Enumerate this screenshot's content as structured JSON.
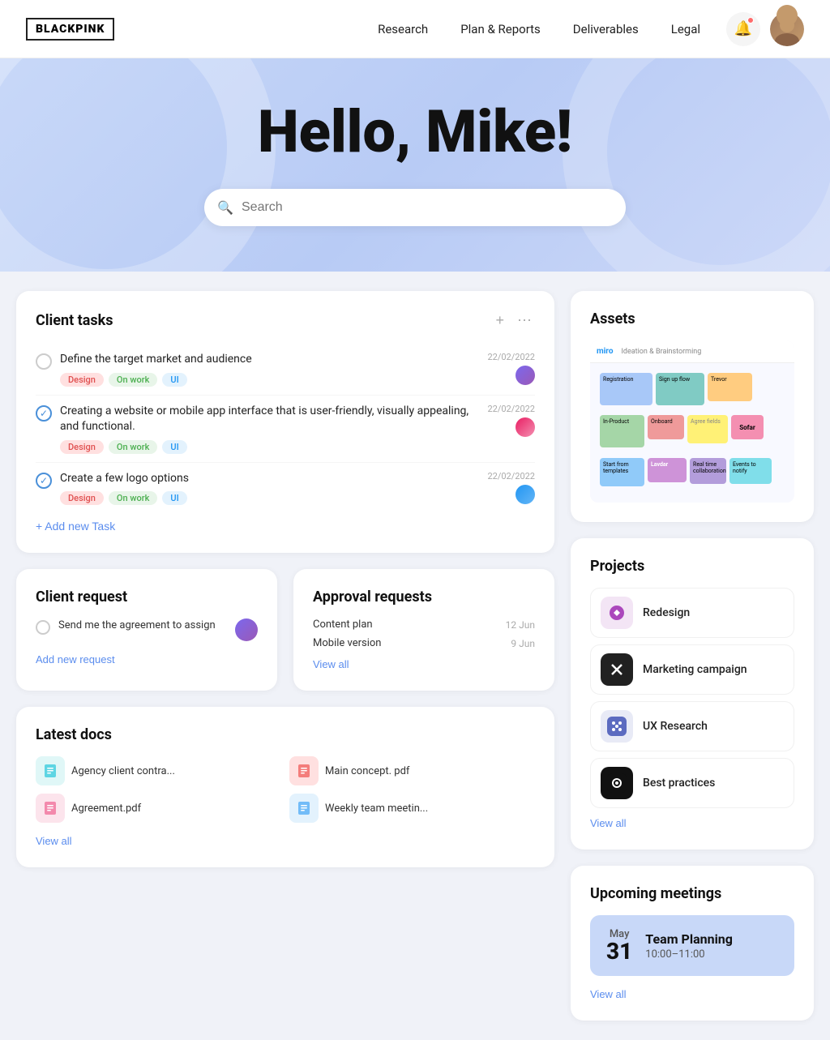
{
  "brand": {
    "logo": "BLACKPINK"
  },
  "nav": {
    "links": [
      {
        "id": "research",
        "label": "Research"
      },
      {
        "id": "plan-reports",
        "label": "Plan & Reports"
      },
      {
        "id": "deliverables",
        "label": "Deliverables"
      },
      {
        "id": "legal",
        "label": "Legal"
      }
    ]
  },
  "hero": {
    "greeting": "Hello, Mike!",
    "search_placeholder": "Search"
  },
  "client_tasks": {
    "title": "Client tasks",
    "tasks": [
      {
        "id": 1,
        "text": "Define the target market and audience",
        "done": false,
        "tags": [
          "Design",
          "On work",
          "UI"
        ],
        "date": "22/02/2022"
      },
      {
        "id": 2,
        "text": "Creating a website or mobile app interface that is user-friendly, visually appealing, and functional.",
        "done": true,
        "tags": [
          "Design",
          "On work",
          "UI"
        ],
        "date": "22/02/2022"
      },
      {
        "id": 3,
        "text": "Create a few logo options",
        "done": true,
        "tags": [
          "Design",
          "On work",
          "UI"
        ],
        "date": "22/02/2022"
      }
    ],
    "add_label": "+ Add new Task"
  },
  "latest_docs": {
    "title": "Latest docs",
    "docs": [
      {
        "id": 1,
        "name": "Agency client contra...",
        "icon": "📄",
        "color": "teal"
      },
      {
        "id": 2,
        "name": "Main concept. pdf",
        "icon": "📄",
        "color": "red"
      },
      {
        "id": 3,
        "name": "Agreement.pdf",
        "icon": "📄",
        "color": "pink"
      },
      {
        "id": 4,
        "name": "Weekly team meetin...",
        "icon": "📄",
        "color": "blue"
      }
    ],
    "view_all": "View all"
  },
  "approval_requests": {
    "title": "Approval requests",
    "items": [
      {
        "id": 1,
        "name": "Content plan",
        "date": "12 Jun"
      },
      {
        "id": 2,
        "name": "Mobile version",
        "date": "9 Jun"
      }
    ],
    "view_all": "View all"
  },
  "client_request": {
    "title": "Client request",
    "text": "Send me the agreement to assign",
    "add_label": "Add new request"
  },
  "assets": {
    "title": "Assets"
  },
  "projects": {
    "title": "Projects",
    "items": [
      {
        "id": 1,
        "name": "Redesign",
        "icon": "🎨",
        "color": "purple"
      },
      {
        "id": 2,
        "name": "Marketing campaign",
        "icon": "✖",
        "color": "dark"
      },
      {
        "id": 3,
        "name": "UX Research",
        "icon": "⋯",
        "color": "blue"
      },
      {
        "id": 4,
        "name": "Best practices",
        "icon": "⚙",
        "color": "black"
      }
    ],
    "view_all": "View all"
  },
  "upcoming_meetings": {
    "title": "Upcoming meetings",
    "meeting": {
      "month": "May",
      "day": "31",
      "title": "Team Planning",
      "time": "10:00–11:00"
    },
    "view_all": "View all"
  }
}
